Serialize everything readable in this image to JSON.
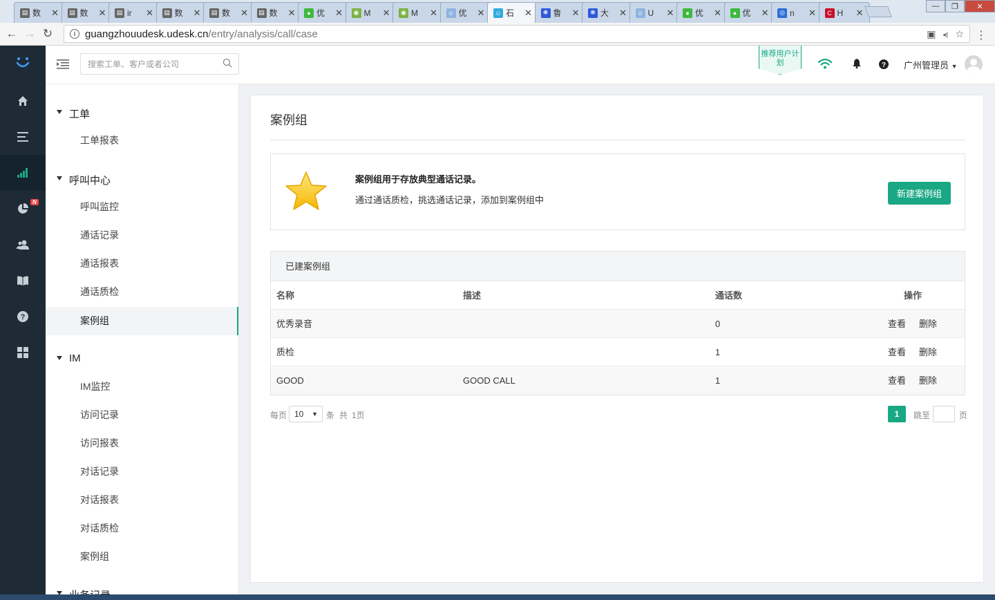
{
  "browser": {
    "tabs": [
      {
        "title": "数",
        "icon": "document-icon",
        "color": "#666666"
      },
      {
        "title": "数",
        "icon": "document-icon",
        "color": "#666666"
      },
      {
        "title": "ir",
        "icon": "document-icon",
        "color": "#666666"
      },
      {
        "title": "数",
        "icon": "document-icon",
        "color": "#666666"
      },
      {
        "title": "数",
        "icon": "document-icon",
        "color": "#666666"
      },
      {
        "title": "数",
        "icon": "document-icon",
        "color": "#666666"
      },
      {
        "title": "优",
        "icon": "wechat-icon",
        "color": "#3eb93e"
      },
      {
        "title": "M",
        "icon": "android-icon",
        "color": "#7cb342"
      },
      {
        "title": "M",
        "icon": "android-icon",
        "color": "#7cb342"
      },
      {
        "title": "优",
        "icon": "udesk-icon",
        "color": "#8fb3e0"
      },
      {
        "title": "石",
        "icon": "udesk-icon",
        "color": "#33aadd"
      },
      {
        "title": "鲁",
        "icon": "baidu-icon",
        "color": "#2f58d8"
      },
      {
        "title": "大",
        "icon": "baidu-icon",
        "color": "#2f58d8"
      },
      {
        "title": "U",
        "icon": "udesk-icon",
        "color": "#8fb3e0"
      },
      {
        "title": "优",
        "icon": "wechat-icon",
        "color": "#3eb93e"
      },
      {
        "title": "优",
        "icon": "wechat-icon",
        "color": "#3eb93e"
      },
      {
        "title": "n",
        "icon": "globe-icon",
        "color": "#2a6fd6"
      },
      {
        "title": "H",
        "icon": "c-logo-icon",
        "color": "#c8102e"
      }
    ],
    "active_tab_index": 10,
    "url_host": "guangzhouudesk.udesk.cn",
    "url_path": "/entry/analysis/call/case"
  },
  "header": {
    "search_placeholder": "搜索工单、客户或者公司",
    "recommend_label": "推荐用户计划",
    "username": "广州管理员"
  },
  "leftnav": {
    "items": [
      {
        "name": "home-icon",
        "active": false
      },
      {
        "name": "list-icon",
        "active": false
      },
      {
        "name": "bar-chart-icon",
        "active": true
      },
      {
        "name": "pie-chart-icon",
        "active": false,
        "badge": "N"
      },
      {
        "name": "users-icon",
        "active": false
      },
      {
        "name": "book-icon",
        "active": false
      },
      {
        "name": "help-icon",
        "active": false
      },
      {
        "name": "apps-icon",
        "active": false
      }
    ]
  },
  "subnav": {
    "groups": [
      {
        "label": "工单",
        "items": [
          "工单报表"
        ]
      },
      {
        "label": "呼叫中心",
        "items": [
          "呼叫监控",
          "通话记录",
          "通话报表",
          "通话质检",
          "案例组"
        ]
      },
      {
        "label": "IM",
        "items": [
          "IM监控",
          "访问记录",
          "访问报表",
          "对话记录",
          "对话报表",
          "对话质检",
          "案例组"
        ]
      },
      {
        "label": "业务记录",
        "items": []
      }
    ],
    "active_item": "案例组"
  },
  "main": {
    "title": "案例组",
    "intro_title": "案例组用于存放典型通话记录。",
    "intro_desc": "通过通话质检，挑选通话记录，添加到案例组中",
    "new_button": "新建案例组",
    "table_title": "已建案例组",
    "columns": [
      "名称",
      "描述",
      "通话数",
      "操作"
    ],
    "rows": [
      {
        "name": "优秀录音",
        "desc": "",
        "count": "0"
      },
      {
        "name": "质检",
        "desc": "",
        "count": "1"
      },
      {
        "name": "GOOD",
        "desc": "GOOD CALL",
        "count": "1"
      }
    ],
    "action_view": "查看",
    "action_delete": "删除",
    "pager": {
      "per_page_label": "每页",
      "per_page_value": "10",
      "unit": "条",
      "total_label": "共",
      "total_pages": "1页",
      "current_page": "1",
      "jump_label": "跳至",
      "page_suffix": "页"
    }
  },
  "colors": {
    "accent": "#19a883",
    "nav_bg": "#1e2b36"
  }
}
